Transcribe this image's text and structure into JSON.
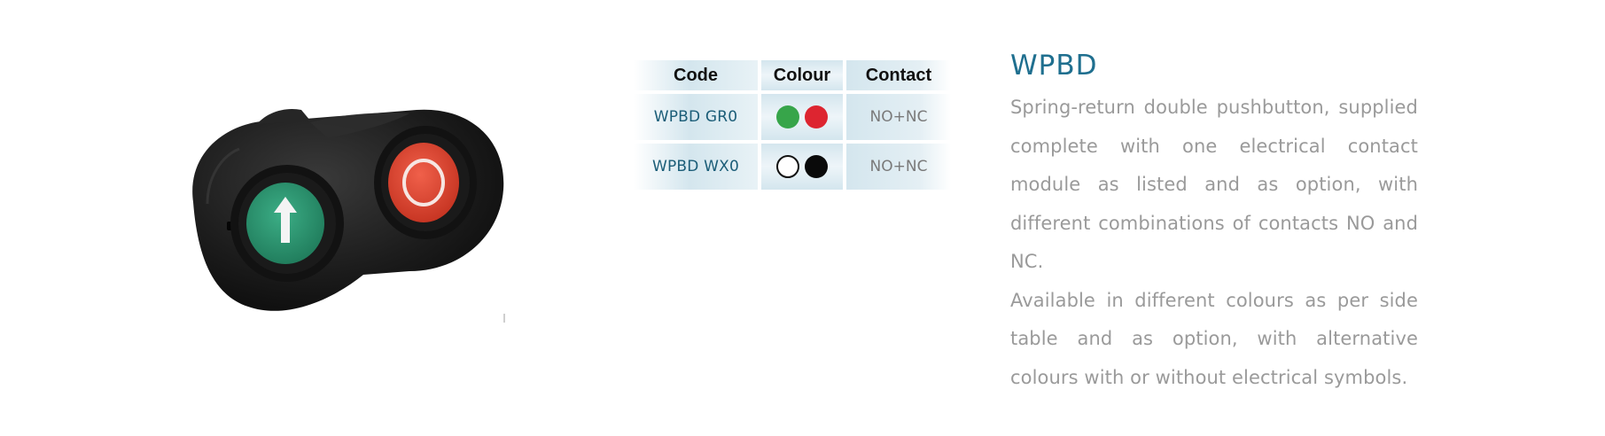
{
  "table": {
    "headers": [
      "Code",
      "Colour",
      "Contact"
    ],
    "rows": [
      {
        "code": "WPBD GR0",
        "colours": [
          "#37a54a",
          "#dd2530"
        ],
        "contact": "NO+NC"
      },
      {
        "code": "WPBD WX0",
        "colours": [
          "#ffffff",
          "#0a0a0a"
        ],
        "contact": "NO+NC"
      }
    ]
  },
  "description": {
    "title": "WPBD",
    "paragraph_1": "Spring-return double pushbutton, supplied complete with one electrical contact module as listed  and as option, with different combinations of contacts NO and NC.",
    "paragraph_2": "Available in different colours as per side table and as option, with alternative colours with or without electrical symbols."
  },
  "product_image": {
    "left_button_color": "#2f9a75",
    "right_button_color": "#e24a34",
    "left_button_icon": "arrow-up-icon",
    "right_button_icon": "ring-icon"
  }
}
